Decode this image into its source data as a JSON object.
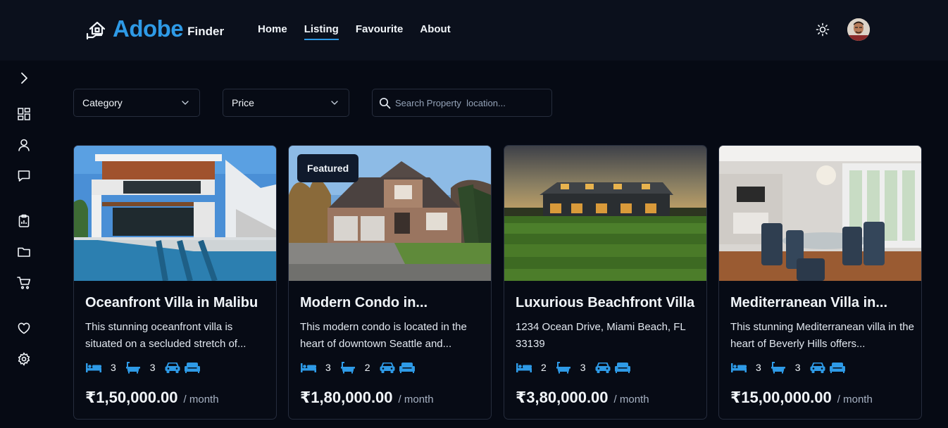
{
  "brand": {
    "name": "Adobe",
    "sub": "Finder"
  },
  "nav": [
    "Home",
    "Listing",
    "Favourite",
    "About"
  ],
  "nav_active": "Listing",
  "filters": {
    "category": "Category",
    "price": "Price",
    "search_placeholder": "Search Property  location..."
  },
  "colors": {
    "accent": "#2e9ae6",
    "background": "#060a14",
    "topbar": "#0b101c"
  },
  "sidebar_icons": [
    "chevron-right-icon",
    "dashboard-icon",
    "user-icon",
    "chat-icon",
    "clipboard-chart-icon",
    "folder-icon",
    "cart-icon",
    "heart-icon",
    "settings-icon"
  ],
  "cards": [
    {
      "title": "Oceanfront Villa in Malibu",
      "desc": "This stunning oceanfront villa is situated on a secluded stretch of...",
      "beds": "3",
      "baths": "3",
      "price": "₹1,50,000.00",
      "per": "/ month",
      "featured": ""
    },
    {
      "title": "Modern Condo in...",
      "desc": "This modern condo is located in the heart of downtown Seattle and...",
      "beds": "3",
      "baths": "2",
      "price": "₹1,80,000.00",
      "per": "/ month",
      "featured": "Featured"
    },
    {
      "title": "Luxurious Beachfront Villa",
      "desc": "1234 Ocean Drive, Miami Beach, FL 33139",
      "beds": "2",
      "baths": "3",
      "price": "₹3,80,000.00",
      "per": "/ month",
      "featured": ""
    },
    {
      "title": "Mediterranean Villa in...",
      "desc": "This stunning Mediterranean villa in the heart of Beverly Hills offers...",
      "beds": "3",
      "baths": "3",
      "price": "₹15,00,000.00",
      "per": "/ month",
      "featured": ""
    }
  ]
}
